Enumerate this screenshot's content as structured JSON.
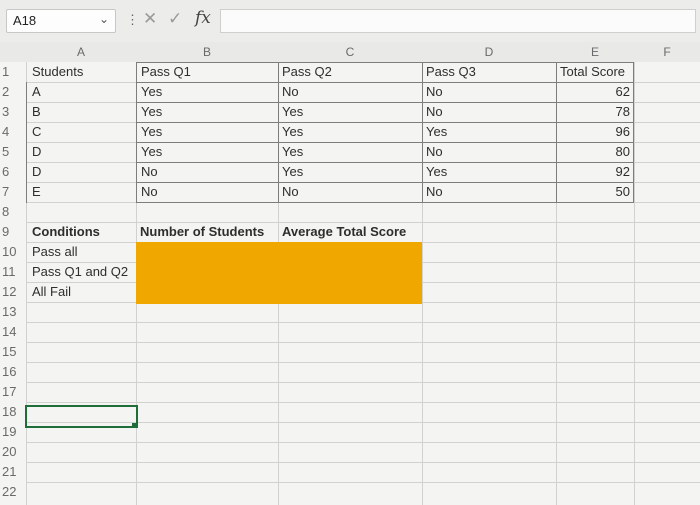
{
  "formula_bar": {
    "name_box": "A18",
    "fx_label": "fx",
    "formula": ""
  },
  "columns": [
    "A",
    "B",
    "C",
    "D",
    "E",
    "F"
  ],
  "rows": [
    "1",
    "2",
    "3",
    "4",
    "5",
    "6",
    "7",
    "8",
    "9",
    "10",
    "11",
    "12",
    "13",
    "14",
    "15",
    "16",
    "17",
    "18",
    "19",
    "20",
    "21",
    "22"
  ],
  "table": {
    "headers": [
      "Students",
      "Pass Q1",
      "Pass Q2",
      "Pass Q3",
      "Total Score"
    ],
    "rows": [
      [
        "A",
        "Yes",
        "No",
        "No",
        "62"
      ],
      [
        "B",
        "Yes",
        "Yes",
        "No",
        "78"
      ],
      [
        "C",
        "Yes",
        "Yes",
        "Yes",
        "96"
      ],
      [
        "D",
        "Yes",
        "Yes",
        "No",
        "80"
      ],
      [
        "D",
        "No",
        "Yes",
        "Yes",
        "92"
      ],
      [
        "E",
        "No",
        "No",
        "No",
        "50"
      ]
    ]
  },
  "summary": {
    "conditions_header": "Conditions",
    "count_header": "Number of Students",
    "avg_header": "Average Total Score",
    "conditions": [
      "Pass all",
      "Pass Q1 and Q2",
      "All Fail"
    ],
    "fill_color": "#f0a800"
  },
  "selected_cell": "A18",
  "icons": {
    "cancel": "x-icon",
    "enter": "check-icon",
    "function": "fx-icon",
    "dropdown": "chevron-down-icon"
  }
}
